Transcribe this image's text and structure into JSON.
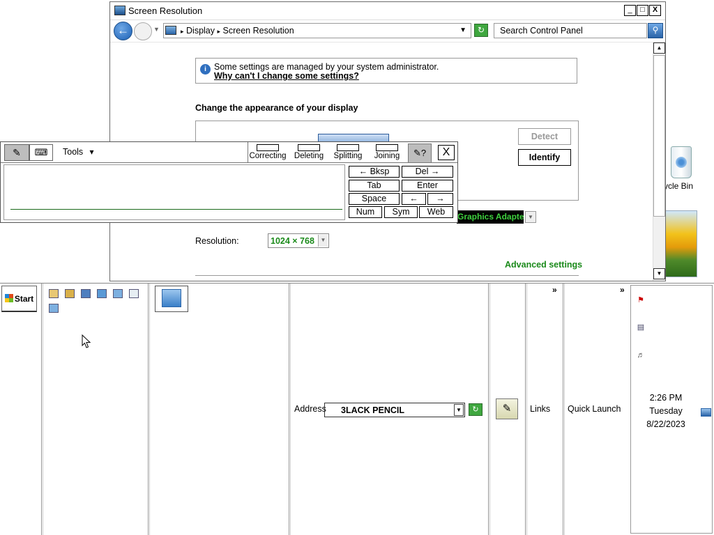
{
  "desktop": {
    "recycle_bin_label": "ycle Bin"
  },
  "window": {
    "title": "Screen Resolution",
    "controls": {
      "minimize": "_",
      "maximize": "□",
      "close": "X"
    },
    "breadcrumb": [
      "Display",
      "Screen Resolution"
    ],
    "search_placeholder": "Search Control Panel",
    "info_text": "Some settings are managed by your system administrator.",
    "info_link": "Why can't I change some settings?",
    "heading": "Change the appearance of your display",
    "detect_label": "Detect",
    "identify_label": "Identify",
    "display_value": "Graphics Adapter",
    "resolution_label": "Resolution:",
    "resolution_value": "1024 × 768",
    "advanced_link": "Advanced settings"
  },
  "input_panel": {
    "tools_label": "Tools",
    "gestures": [
      "Correcting",
      "Deleting",
      "Splitting",
      "Joining"
    ],
    "keys": {
      "bksp": "← Bksp",
      "del": "Del →",
      "tab": "Tab",
      "enter": "Enter",
      "space": "Space",
      "left": "←",
      "right": "→",
      "num": "Num",
      "sym": "Sym",
      "web": "Web"
    },
    "close_label": "X"
  },
  "taskbar": {
    "start_label": "Start",
    "address_label": "Address",
    "address_value": "3LACK PENCIL",
    "links_label": "Links",
    "quick_launch_label": "Quick Launch",
    "chevron": "»",
    "clock": {
      "time": "2:26 PM",
      "day": "Tuesday",
      "date": "8/22/2023"
    }
  }
}
